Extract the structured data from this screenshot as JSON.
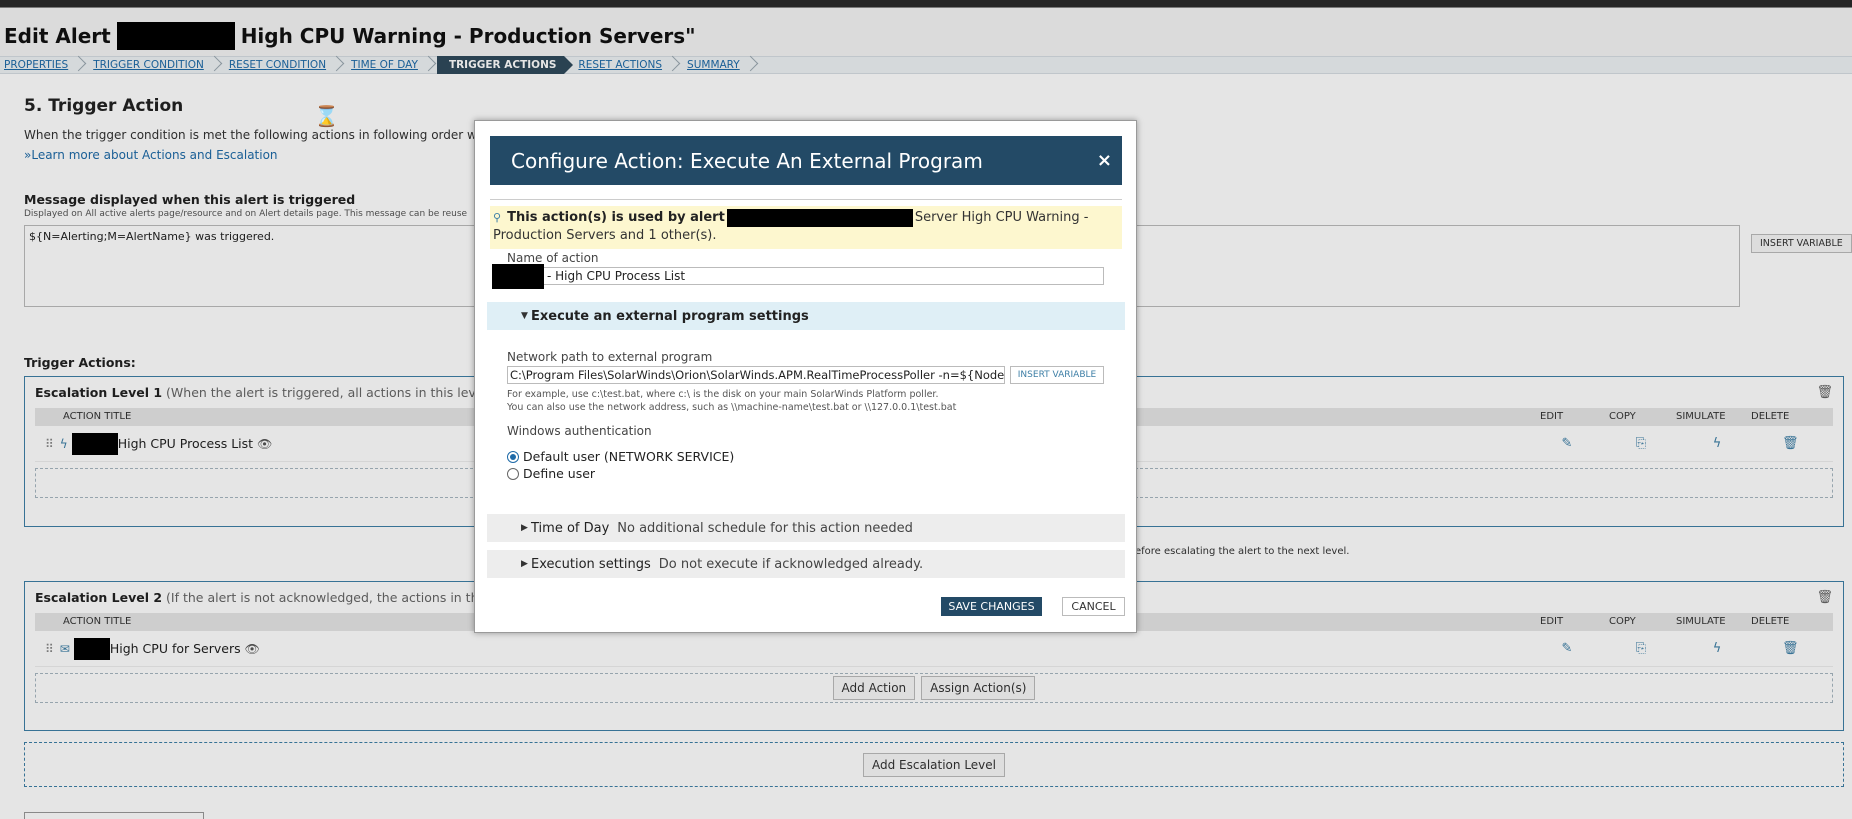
{
  "page": {
    "title_prefix": "Edit Alert",
    "title_suffix": "High CPU Warning - Production Servers\""
  },
  "wizard": {
    "steps": [
      {
        "label": "PROPERTIES",
        "active": false
      },
      {
        "label": "TRIGGER CONDITION",
        "active": false
      },
      {
        "label": "RESET CONDITION",
        "active": false
      },
      {
        "label": "TIME OF DAY",
        "active": false
      },
      {
        "label": "TRIGGER ACTIONS",
        "active": true
      },
      {
        "label": "RESET ACTIONS",
        "active": false
      },
      {
        "label": "SUMMARY",
        "active": false
      }
    ]
  },
  "section": {
    "title": "5. Trigger Action",
    "description": "When the trigger condition is met the following actions in following order will be",
    "learn_more": "»Learn more about Actions and Escalation"
  },
  "message": {
    "label": "Message displayed when this alert is triggered",
    "sublabel": "Displayed on All active alerts page/resource and on Alert details page. This message can be reuse",
    "value": "${N=Alerting;M=AlertName} was triggered.",
    "insert_variable": "INSERT VARIABLE"
  },
  "trigger_actions_label": "Trigger Actions:",
  "columns": {
    "action_title": "ACTION TITLE",
    "edit": "EDIT",
    "copy": "COPY",
    "simulate": "SIMULATE",
    "delete": "DELETE"
  },
  "escalation1": {
    "title": "Escalation Level 1",
    "note": "(When the alert is triggered, all actions in this level fire.)",
    "action_title": "High CPU Process List"
  },
  "between_note": "efore escalating the alert to the next level.",
  "escalation2": {
    "title": "Escalation Level 2",
    "note": "(If the alert is not acknowledged, the actions in this escalati",
    "action_title": "High CPU for Servers",
    "add_action": "Add Action",
    "assign_actions": "Assign Action(s)"
  },
  "add_escalation_level": "Add Escalation Level",
  "modal": {
    "title": "Configure Action: Execute An External Program",
    "close": "×",
    "info_bold": "This action(s) is used by alert",
    "info_rest_line1": "Server High CPU Warning -",
    "info_rest_line2": "Production Servers and 1 other(s).",
    "name_label": "Name of action",
    "name_value": "- High CPU Process List",
    "section_title": "Execute an external program settings",
    "path_label": "Network path to external program",
    "path_value": "C:\\Program Files\\SolarWinds\\Orion\\SolarWinds.APM.RealTimeProcessPoller -n=${NodeID}",
    "insert_variable": "INSERT VARIABLE",
    "hint1": "For example, use c:\\test.bat, where c:\\ is the disk on your main SolarWinds Platform poller.",
    "hint2": "You can also use the network address, such as \\\\machine-name\\test.bat or \\\\127.0.0.1\\test.bat",
    "auth_label": "Windows authentication",
    "radio_default": "Default user (NETWORK SERVICE)",
    "radio_define": "Define user",
    "time_of_day_title": "Time of Day",
    "time_of_day_summary": "No additional schedule for this action needed",
    "execution_title": "Execution settings",
    "execution_summary": "Do not execute if acknowledged already.",
    "save": "SAVE CHANGES",
    "cancel": "CANCEL"
  },
  "colors": {
    "modal_header": "#234a66",
    "accent": "#3e7fa6",
    "link": "#1e6aa8",
    "info_bg": "#fdf7cf",
    "section_bg": "#dfeff6"
  }
}
